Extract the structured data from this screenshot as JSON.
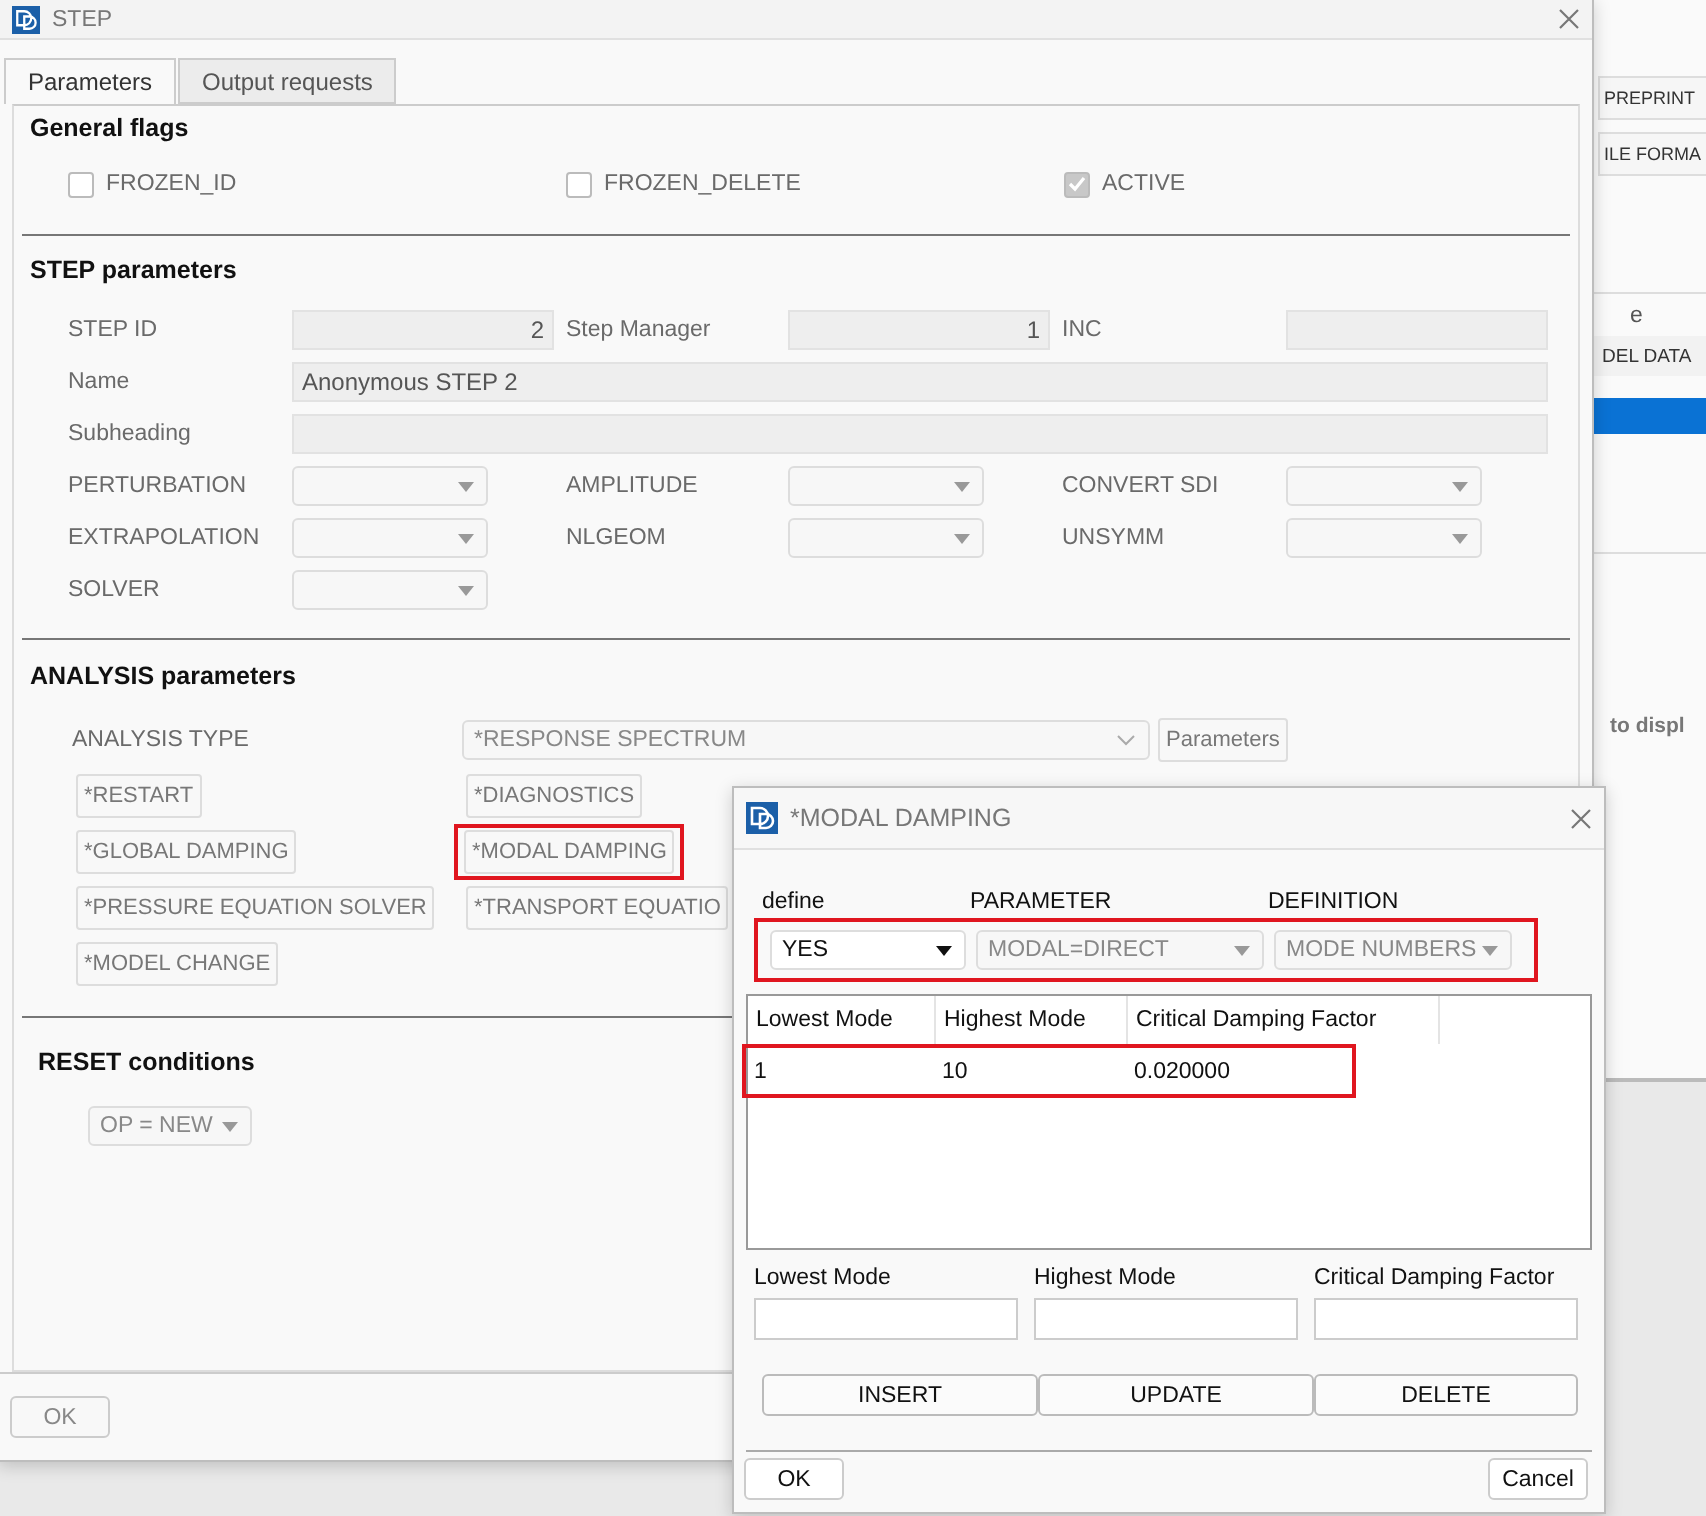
{
  "step_window": {
    "title": "STEP",
    "tabs": [
      {
        "label": "Parameters",
        "selected": true
      },
      {
        "label": "Output requests",
        "selected": false
      }
    ],
    "general_flags": {
      "heading": "General flags",
      "flags": [
        {
          "label": "FROZEN_ID",
          "checked": false
        },
        {
          "label": "FROZEN_DELETE",
          "checked": false
        },
        {
          "label": "ACTIVE",
          "checked": true
        }
      ]
    },
    "step_parameters": {
      "heading": "STEP parameters",
      "rows": [
        [
          {
            "kind": "number",
            "label": "STEP ID",
            "value": "2"
          },
          {
            "kind": "number",
            "label": "Step Manager",
            "value": "1"
          },
          {
            "kind": "number",
            "label": "INC"
          }
        ],
        [
          {
            "kind": "wide",
            "label": "Name",
            "value": "Anonymous STEP 2"
          }
        ],
        [
          {
            "kind": "wide",
            "label": "Subheading"
          }
        ],
        [
          {
            "kind": "select",
            "label": "PERTURBATION"
          },
          {
            "kind": "select",
            "label": "AMPLITUDE"
          },
          {
            "kind": "select",
            "label": "CONVERT SDI"
          }
        ],
        [
          {
            "kind": "select",
            "label": "EXTRAPOLATION"
          },
          {
            "kind": "select",
            "label": "NLGEOM"
          },
          {
            "kind": "select",
            "label": "UNSYMM"
          }
        ],
        [
          {
            "kind": "select",
            "label": "SOLVER"
          }
        ]
      ]
    },
    "analysis_parameters": {
      "heading": "ANALYSIS parameters",
      "analysis_type": {
        "label": "ANALYSIS TYPE",
        "value": "*RESPONSE SPECTRUM"
      },
      "parameters_button": "Parameters",
      "keyword_rows": [
        [
          {
            "label": "*RESTART",
            "highlighted": false
          },
          {
            "label": "*DIAGNOSTICS",
            "highlighted": false
          }
        ],
        [
          {
            "label": "*GLOBAL DAMPING",
            "highlighted": false
          },
          {
            "label": "*MODAL DAMPING",
            "highlighted": true
          }
        ],
        [
          {
            "label": "*PRESSURE EQUATION SOLVER",
            "highlighted": false
          },
          {
            "label": "*TRANSPORT EQUATIO",
            "highlighted": false
          }
        ],
        [
          {
            "label": "*MODEL CHANGE",
            "highlighted": false
          }
        ]
      ]
    },
    "reset_conditions": {
      "heading": "RESET conditions",
      "op": "OP = NEW"
    },
    "footer_buttons": [
      "OK"
    ]
  },
  "background_window": {
    "buttons": [
      "PREPRINT",
      "ILE FORMA"
    ],
    "column_header": "e",
    "list_items": [
      {
        "label": "DEL DATA",
        "selected": false
      },
      {
        "selected": true
      }
    ],
    "hint": "to displ"
  },
  "modal_window": {
    "title": "*MODAL DAMPING",
    "options_highlighted": true,
    "options": [
      {
        "label": "define",
        "value": "YES",
        "disabled": false
      },
      {
        "label": "PARAMETER",
        "value": "MODAL=DIRECT",
        "disabled": true
      },
      {
        "label": "DEFINITION",
        "value": "MODE NUMBERS",
        "disabled": true
      }
    ],
    "table": {
      "columns": [
        "Lowest Mode",
        "Highest Mode",
        "Critical Damping Factor"
      ],
      "rows": [
        {
          "cells": [
            "1",
            "10",
            "0.020000"
          ],
          "highlighted": true
        }
      ]
    },
    "inputs": [
      {
        "label": "Lowest Mode"
      },
      {
        "label": "Highest Mode"
      },
      {
        "label": "Critical Damping Factor"
      }
    ],
    "actions": [
      "INSERT",
      "UPDATE",
      "DELETE"
    ],
    "ok": "OK",
    "cancel": "Cancel"
  }
}
